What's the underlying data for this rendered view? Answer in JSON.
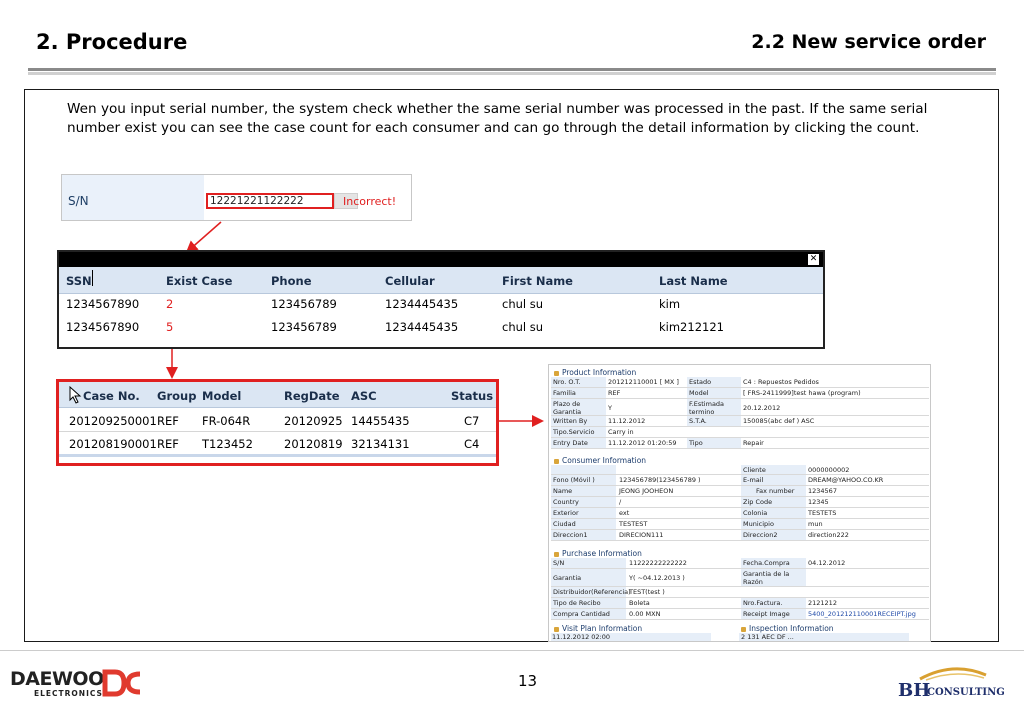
{
  "header": {
    "left_title": "2. Procedure",
    "right_title": "2.2 New service order"
  },
  "intro_text": "Wen you input serial number, the system check whether the same serial number was processed in the past. If the same serial number exist you can see the case count for each consumer and can go through the detail information by clicking the count.",
  "serial_check": {
    "label": "S/N",
    "value": "12221221122222",
    "error": "Incorrect!"
  },
  "ssn_popup": {
    "close_icon": "close-icon",
    "columns": [
      "SSN",
      "Exist Case",
      "Phone",
      "Cellular",
      "First Name",
      "Last Name"
    ],
    "rows": [
      {
        "ssn": "1234567890",
        "exist_case": "2",
        "phone": "123456789",
        "cellular": "1234445435",
        "first_name": "chul su",
        "last_name": "kim"
      },
      {
        "ssn": "1234567890",
        "exist_case": "5",
        "phone": "123456789",
        "cellular": "1234445435",
        "first_name": "chul su",
        "last_name": "kim212121"
      }
    ]
  },
  "case_table": {
    "columns": [
      "Case No.",
      "Group",
      "Model",
      "RegDate",
      "ASC",
      "Status"
    ],
    "rows": [
      {
        "case_no": "201209250001",
        "group": "REF",
        "model": "FR-064R",
        "reg_date": "20120925",
        "asc": "14455435",
        "status": "C7"
      },
      {
        "case_no": "201208190001",
        "group": "REF",
        "model": "T123452",
        "reg_date": "20120819",
        "asc": "32134131",
        "status": "C4"
      }
    ]
  },
  "detail": {
    "product": {
      "title": "Product Information",
      "r1": [
        "Nro. O.T.",
        "201212110001 [ MX ]",
        "Estado",
        "C4 : Repuestos Pedidos"
      ],
      "r2": [
        "Familia",
        "REF",
        "Model",
        "[ FRS-2411999]test hawa (program)"
      ],
      "r3": [
        "Plazo de Garantia",
        "Y",
        "F.Estimada termino",
        "20.12.2012"
      ],
      "r4": [
        "Written By",
        "11.12.2012",
        "S.T.A.",
        "150085(abc def ) ASC"
      ],
      "r5": [
        "Tipo.Servicio",
        "Carry in"
      ],
      "r6": [
        "Entry Date",
        "11.12.2012 01:20:59",
        "Tipo",
        "Repair"
      ]
    },
    "consumer": {
      "title": "Consumer Information",
      "r1": [
        "Cliente",
        "0000000002"
      ],
      "r2": [
        "Fono (Móvil )",
        "123456789(123456789 )",
        "E-mail",
        "DREAM@YAHOO.CO.KR"
      ],
      "r3": [
        "Name",
        "JEONG JOOHEON",
        "Fax number",
        "1234567"
      ],
      "r4": [
        "Country",
        "/",
        "Zip Code",
        "12345"
      ],
      "r5": [
        "Exterior",
        "ext",
        "Colonia",
        "TESTETS"
      ],
      "r6": [
        "Ciudad",
        "TESTEST",
        "Municipio",
        "mun"
      ],
      "r7": [
        "Direccion1",
        "DIRECION111",
        "Direccion2",
        "direction222"
      ]
    },
    "purchase": {
      "title": "Purchase Information",
      "r1": [
        "S/N",
        "11222222222222",
        "Fecha.Compra",
        "04.12.2012"
      ],
      "r2": [
        "Garantia",
        "Y( ~04.12.2013 )",
        "Garantia de la Razón"
      ],
      "r3": [
        "Distribuidor(Referencia)",
        "TEST(test )"
      ],
      "r4": [
        "Tipo de Recibo",
        "Boleta",
        "Nro.Factura.",
        "2121212"
      ],
      "r5": [
        "Compra Cantidad",
        "0.00   MXN",
        "Receipt Image",
        "5400_201212110001RECEIPT.jpg"
      ]
    },
    "visit": {
      "title": "Visit Plan Information",
      "value": "11.12.2012   02:00"
    },
    "inspection": {
      "title": "Inspection Information",
      "value": "2    131  AEC  DF    ..."
    }
  },
  "footer": {
    "page_number": "13",
    "left_logo_text": "DAEWOO",
    "left_logo_sub": "ELECTRONICS",
    "right_logo_text": "BH",
    "right_logo_sub": "CONSULTING"
  },
  "colors": {
    "accent_red": "#e02020",
    "header_blue": "#dbe6f3",
    "daewoo_red": "#e03a2e",
    "bh_navy": "#1f2f6b",
    "bh_gold": "#d9a030"
  }
}
